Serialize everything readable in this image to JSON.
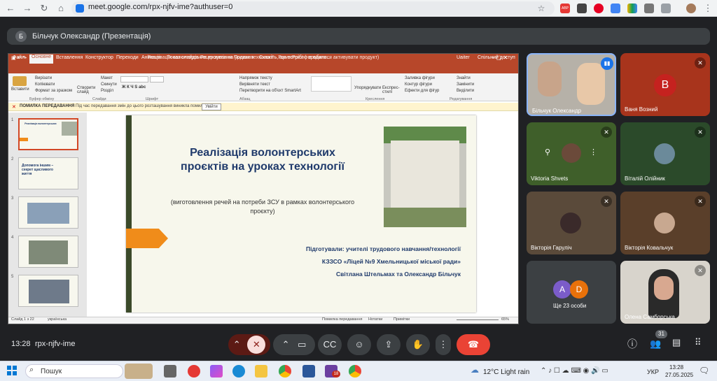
{
  "browser": {
    "url": "meet.google.com/rpx-njfv-ime?authuser=0",
    "ext_abp": "ABP"
  },
  "meet": {
    "presenter_initial": "Б",
    "presenter_title": "Більчук Олександр (Презентація)",
    "time": "13:28",
    "meeting_code": "rpx-njfv-ime",
    "participant_count": "31"
  },
  "ppt": {
    "window_title": "Реалізація волонтерських проєктів на уроках технології - PowerPoint (не вдалося активувати продукт)",
    "tabs": [
      "Файл",
      "Основне",
      "Вставлення",
      "Конструктор",
      "Переходи",
      "Анімація",
      "Показ слайдів",
      "Рецензування",
      "Подання",
      "Скажіть, що потрібно зробити..."
    ],
    "user": "Uaiter",
    "share": "Спільний доступ",
    "clipboard": {
      "paste": "Вставити",
      "cut": "Вирізати",
      "copy": "Копіювати",
      "format": "Формат за зразком",
      "group": "Буфер обміну"
    },
    "slides_group": {
      "new": "Створити слайд",
      "layout": "Макет",
      "reset": "Скинути",
      "section": "Розділ",
      "group": "Слайди"
    },
    "font_group": "Шрифт",
    "paragraph": {
      "direction": "Напрямок тексту",
      "align": "Вирівняти текст",
      "smartart": "Перетворити на об'єкт SmartArt",
      "group": "Абзац"
    },
    "drawing": {
      "arrange": "Упорядкувати",
      "styles": "Експрес-стилі",
      "fill": "Заливка фігури",
      "outline": "Контур фігури",
      "effects": "Ефекти для фігур",
      "group": "Креслення"
    },
    "editing": {
      "find": "Знайти",
      "replace": "Замінити",
      "select": "Виділити",
      "group": "Редагування"
    },
    "error_title": "ПОМИЛКА ПЕРЕДАВАННЯ",
    "error_msg": "Під час передавання змін до цього розташування виникла помилка.",
    "error_btn": "Увійти",
    "thumb_numbers": [
      "1",
      "2",
      "3",
      "4",
      "5"
    ],
    "thumb2_text": "Допомога іншим – секрет щасливого життя",
    "status_slide": "Слайд 1 з 22",
    "status_lang": "українська",
    "status_upload": "Помилка передавання",
    "status_notes": "Нотатки",
    "status_comments": "Примітки",
    "zoom": "65%"
  },
  "slide": {
    "title_line1": "Реалізація волонтерських",
    "title_line2": "проєктів на уроках технології",
    "subtitle": "(виготовлення речей на потреби ЗСУ в рамках волонтерського проєкту)",
    "author1": "Підготували: учителі трудового навчання/технології",
    "author2": "КЗЗСО «Ліцей №9 Хмельницької міської ради»",
    "author3": "Світлана Штельмах та Олександр Більчук"
  },
  "tiles": [
    {
      "name": "Більчук Олександр"
    },
    {
      "name": "Ваня Возний",
      "initial": "В"
    },
    {
      "name": "Viktoria Shvets"
    },
    {
      "name": "Віталій Олійник"
    },
    {
      "name": "Вікторія Гаруліч"
    },
    {
      "name": "Вікторія Ковальчук"
    },
    {
      "name": "Ще 23 особи",
      "a": "A",
      "d": "D"
    },
    {
      "name": "Олена Самборська"
    }
  ],
  "taskbar": {
    "search": "Пошук",
    "weather": "12°C  Light rain",
    "lang": "УКР",
    "time": "13:28",
    "date": "27.05.2025",
    "outlook_badge": "18"
  },
  "colors": {
    "ppt_red": "#b7472a",
    "meet_bg": "#202124",
    "end_call": "#ea4335",
    "warning": "#fff4ce"
  }
}
